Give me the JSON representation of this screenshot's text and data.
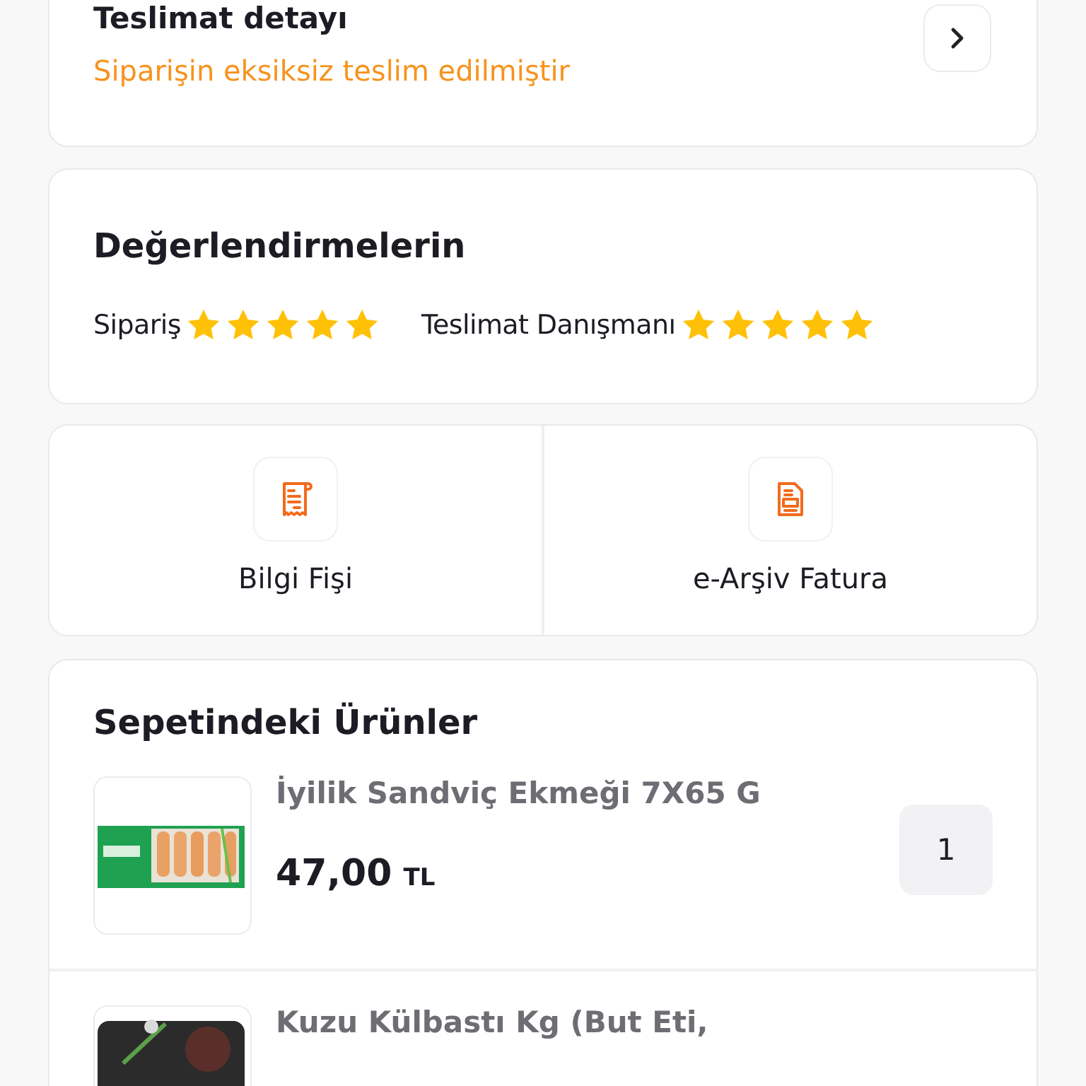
{
  "delivery": {
    "title": "Teslimat detayı",
    "status": "Siparişin eksiksiz teslim edilmiştir"
  },
  "ratings": {
    "title": "Değerlendirmelerin",
    "items": [
      {
        "label": "Sipariş",
        "stars": 5
      },
      {
        "label": "Teslimat Danışmanı",
        "stars": 5
      }
    ]
  },
  "documents": [
    {
      "kind": "receipt",
      "label": "Bilgi Fişi"
    },
    {
      "kind": "invoice",
      "label": "e-Arşiv Fatura"
    }
  ],
  "cart": {
    "title": "Sepetindeki Ürünler",
    "items": [
      {
        "name": "İyilik Sandviç Ekmeği 7X65 G",
        "price": "47,00",
        "currency": "TL",
        "quantity": "1",
        "kind": "picture"
      },
      {
        "name": "Kuzu Külbastı Kg (But Eti,",
        "kind": "picture"
      }
    ]
  }
}
